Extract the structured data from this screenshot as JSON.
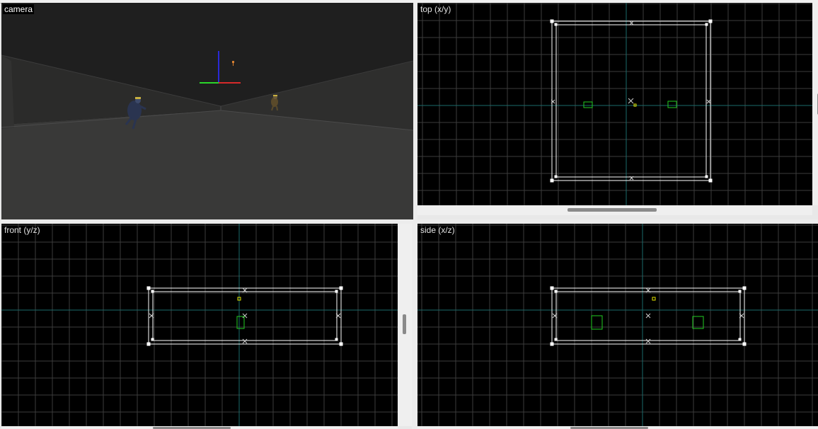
{
  "viewports": {
    "camera": {
      "label": "camera"
    },
    "top": {
      "label": "top (x/y)"
    },
    "front": {
      "label": "front (y/z)"
    },
    "side": {
      "label": "side (x/z)"
    }
  },
  "colors": {
    "grid_line": "#3c3c3c",
    "axis_line": "#1a6a6a",
    "brush": "#ffffff",
    "entity": "#22cc22",
    "light": "#e6e600",
    "viewport_bg": "#000000",
    "camera_floor": "#3a3a3a",
    "camera_wall": "#2c2c2c",
    "camera_ceiling": "#222222"
  },
  "icons": {
    "axis_gizmo": "xyz-gizmo-icon",
    "brush_center": "x-marker-icon",
    "player_model": "player-model-icon"
  }
}
